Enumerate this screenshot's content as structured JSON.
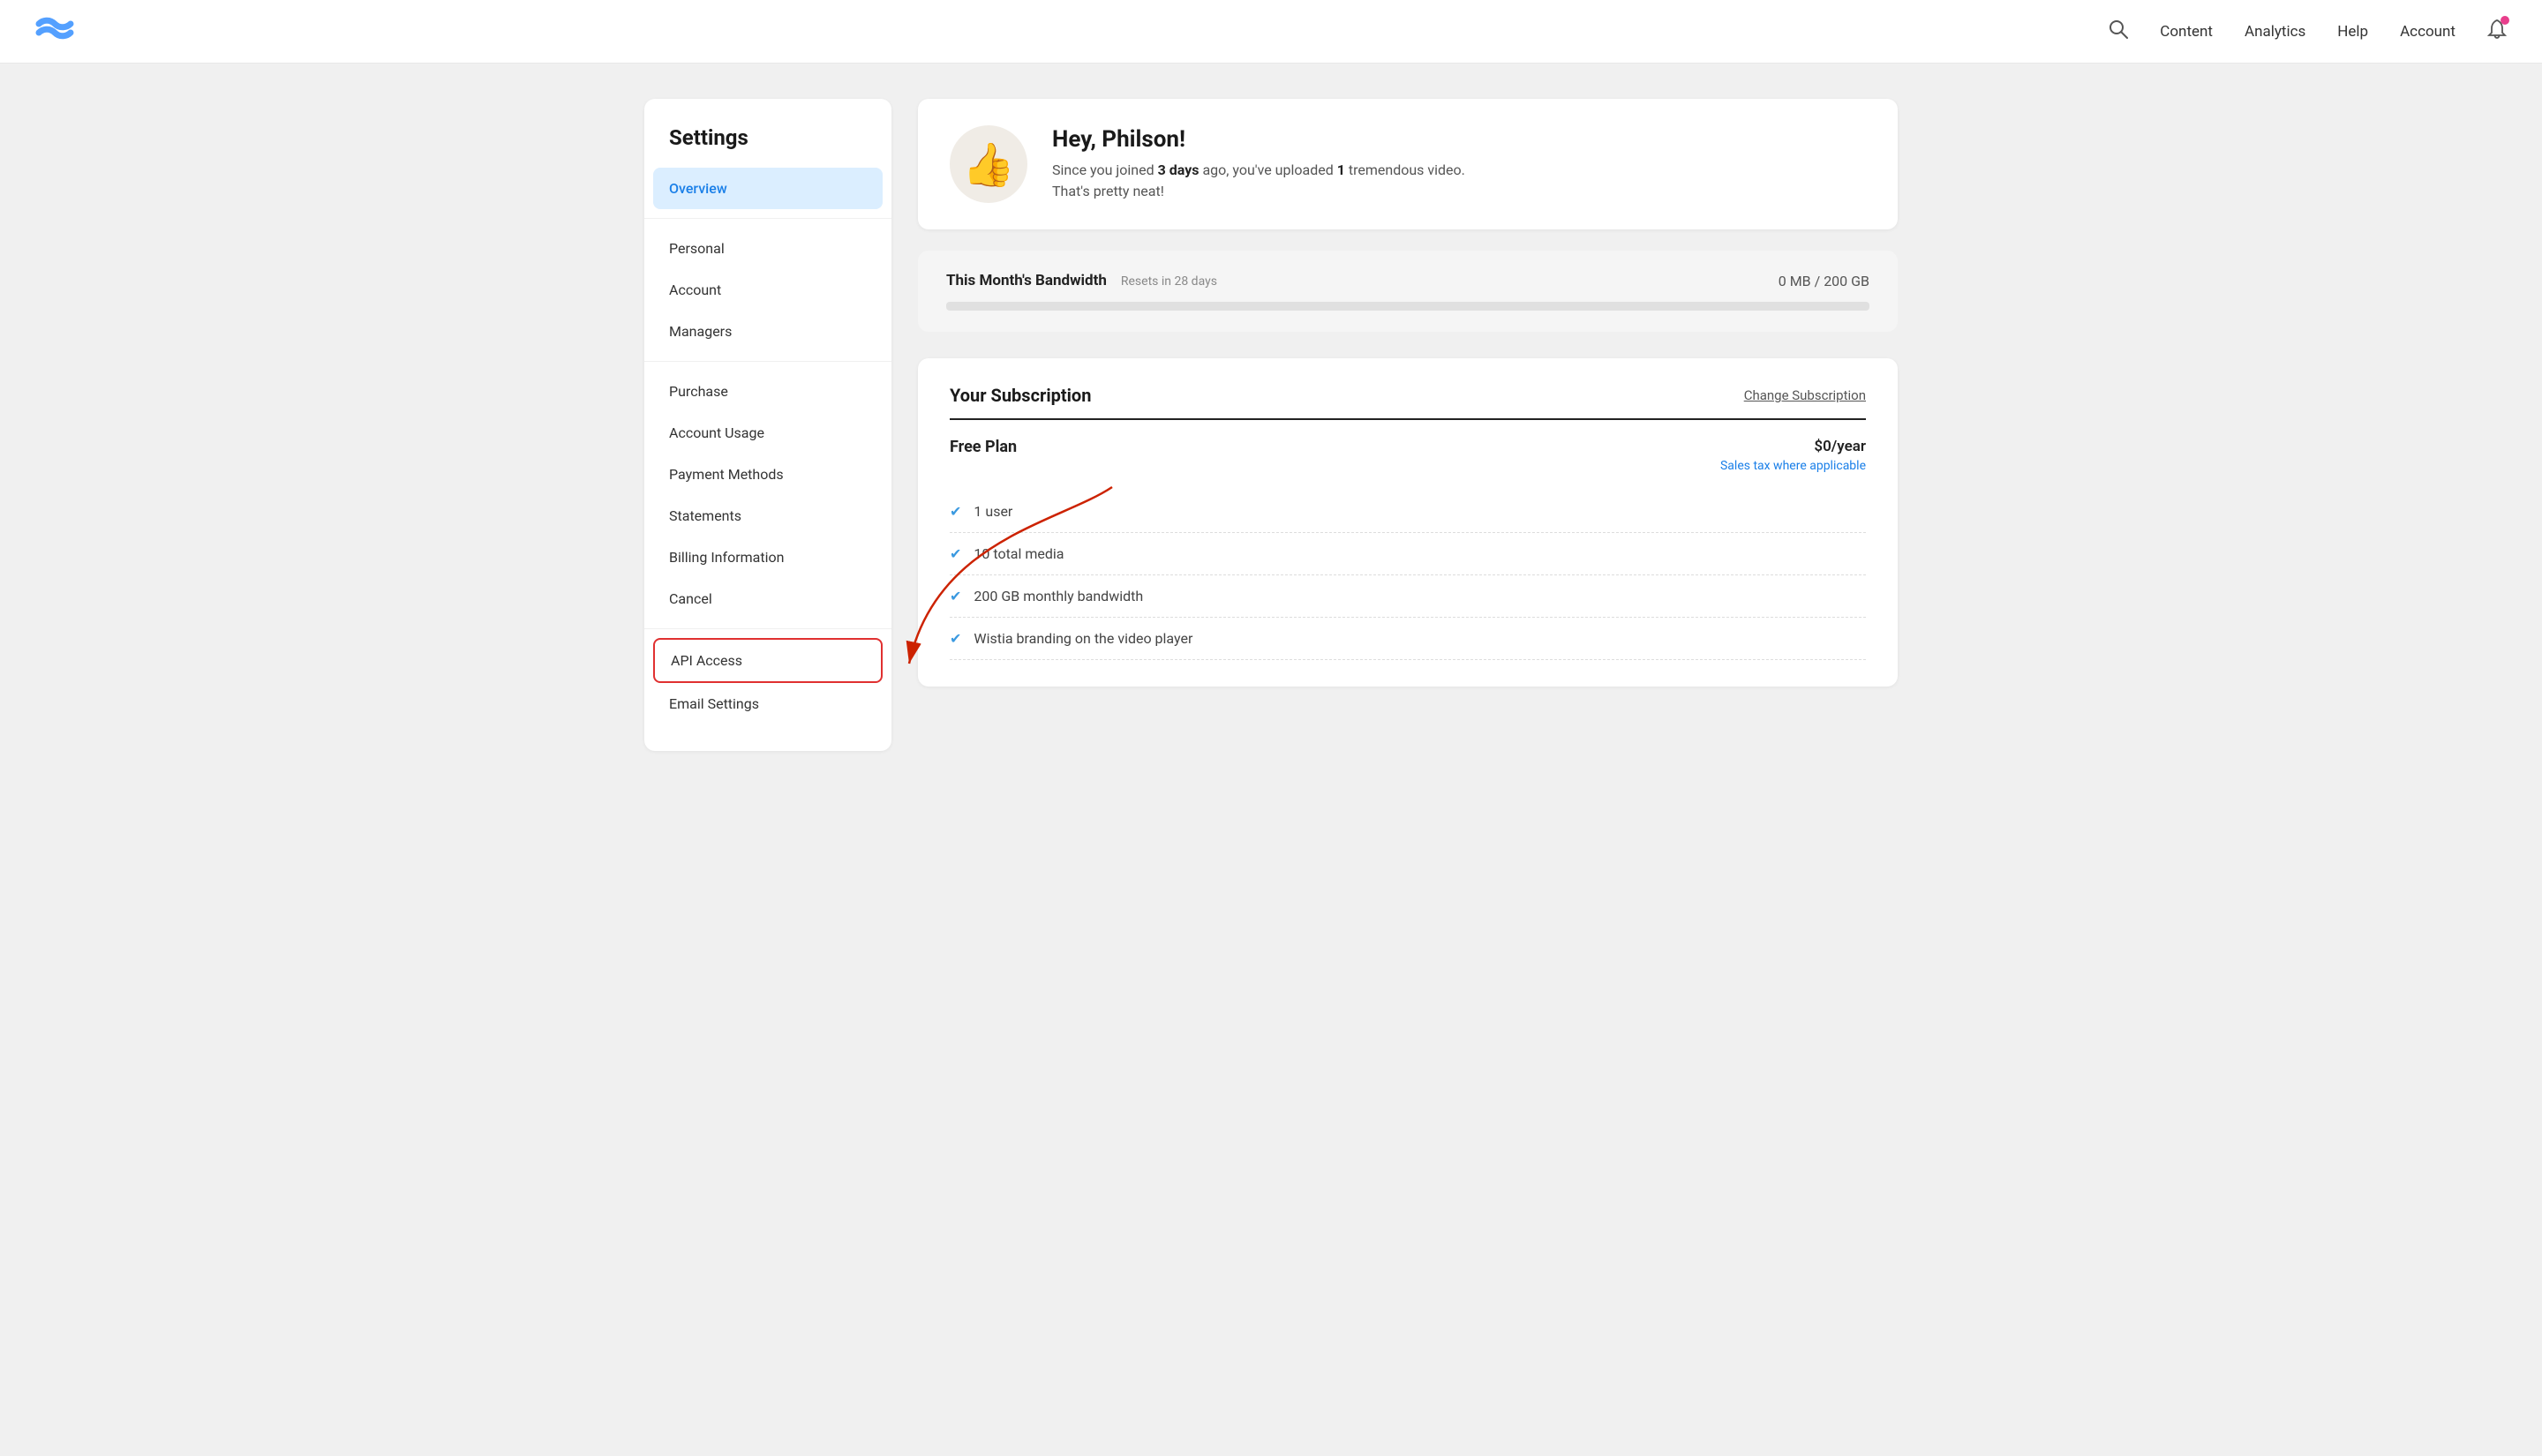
{
  "topnav": {
    "search_label": "🔍",
    "links": [
      "Content",
      "Analytics",
      "Help",
      "Account"
    ],
    "content_label": "Content",
    "analytics_label": "Analytics",
    "help_label": "Help",
    "account_label": "Account"
  },
  "sidebar": {
    "title": "Settings",
    "items": [
      {
        "id": "overview",
        "label": "Overview",
        "active": true
      },
      {
        "id": "personal",
        "label": "Personal",
        "active": false
      },
      {
        "id": "account",
        "label": "Account",
        "active": false
      },
      {
        "id": "managers",
        "label": "Managers",
        "active": false
      },
      {
        "id": "purchase",
        "label": "Purchase",
        "active": false
      },
      {
        "id": "account-usage",
        "label": "Account Usage",
        "active": false
      },
      {
        "id": "payment-methods",
        "label": "Payment Methods",
        "active": false
      },
      {
        "id": "statements",
        "label": "Statements",
        "active": false
      },
      {
        "id": "billing-information",
        "label": "Billing Information",
        "active": false
      },
      {
        "id": "cancel",
        "label": "Cancel",
        "active": false
      },
      {
        "id": "api-access",
        "label": "API Access",
        "active": false,
        "highlighted": true
      },
      {
        "id": "email-settings",
        "label": "Email Settings",
        "active": false
      }
    ]
  },
  "welcome": {
    "avatar_emoji": "👍",
    "greeting": "Hey, Philson!",
    "line1_prefix": "Since you joined ",
    "days": "3 days",
    "line1_middle": " ago, you've uploaded ",
    "count": "1",
    "line1_suffix": " tremendous video.",
    "line2": "That's pretty neat!"
  },
  "bandwidth": {
    "title": "This Month's Bandwidth",
    "subtitle": "Resets in 28 days",
    "value": "0 MB / 200 GB",
    "fill_percent": 0
  },
  "subscription": {
    "section_title": "Your Subscription",
    "change_link": "Change Subscription",
    "plan_name": "Free Plan",
    "price": "$0/year",
    "price_sub": "Sales tax where applicable",
    "features": [
      "1 user",
      "10 total media",
      "200 GB monthly bandwidth",
      "Wistia branding on the video player"
    ]
  }
}
